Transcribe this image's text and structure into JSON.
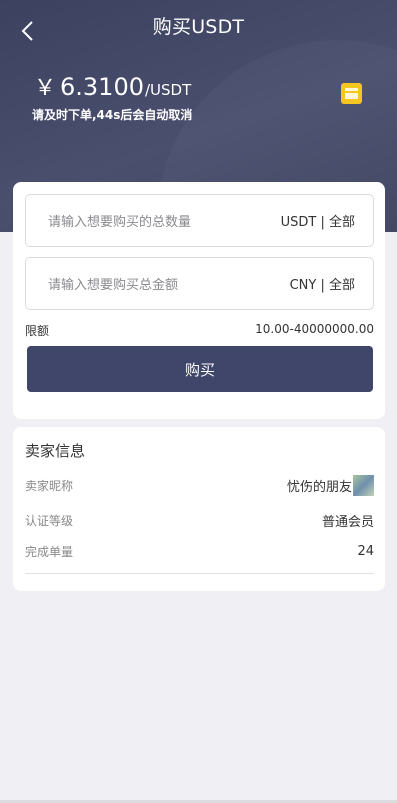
{
  "header": {
    "title": "购买USDT",
    "price_symbol": "￥",
    "price": "6.3100",
    "price_unit": "/USDT",
    "notice": "请及时下单,44s后会自动取消",
    "order_icon": "order-list-icon",
    "back_icon": "chevron-left-icon"
  },
  "form": {
    "qty_placeholder": "请输入想要购买的总数量",
    "qty_suffix_unit": "USDT | ",
    "qty_suffix_all": "全部",
    "amount_placeholder": "请输入想要购买总金额",
    "amount_suffix_unit": "CNY | ",
    "amount_suffix_all": "全部",
    "limit_label": "限额",
    "limit_value": "10.00-40000000.00",
    "buy_label": "购买"
  },
  "seller": {
    "title": "卖家信息",
    "nickname_label": "卖家昵称",
    "nickname_value": "忧伤的朋友",
    "level_label": "认证等级",
    "level_value": "普通会员",
    "orders_label": "完成单量",
    "orders_value": "24"
  },
  "colors": {
    "header_bg": "#3c4160",
    "button_bg": "#40456a",
    "icon_yellow": "#f5c518",
    "page_bg": "#efeff4"
  }
}
